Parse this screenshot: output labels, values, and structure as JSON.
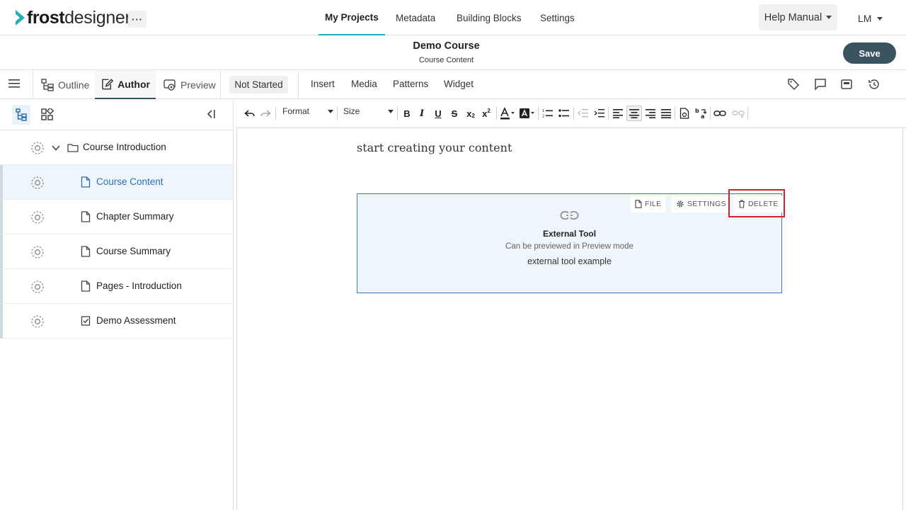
{
  "app": {
    "brand_strong": "frost",
    "brand_light": "designer",
    "more_label": "···",
    "colors": {
      "accent": "#21b0b7",
      "primary": "#3a5360",
      "selection": "#2a6fb5",
      "highlight": "#d0222a"
    }
  },
  "topnav": {
    "tabs": [
      {
        "label": "My Projects",
        "active": true
      },
      {
        "label": "Metadata"
      },
      {
        "label": "Building Blocks"
      },
      {
        "label": "Settings"
      }
    ],
    "help_label": "Help Manual",
    "user_initials": "LM"
  },
  "header": {
    "title": "Demo Course",
    "subtitle": "Course Content",
    "save_label": "Save"
  },
  "modebar": {
    "tabs": [
      {
        "label": "Outline",
        "icon": "outline-icon"
      },
      {
        "label": "Author",
        "icon": "author-icon",
        "active": true
      },
      {
        "label": "Preview",
        "icon": "preview-icon"
      }
    ],
    "status": "Not Started",
    "menu": [
      "Insert",
      "Media",
      "Patterns",
      "Widget"
    ],
    "right_icons": [
      "tag-icon",
      "comment-icon",
      "notes-icon",
      "history-icon"
    ]
  },
  "sidebar": {
    "items": [
      {
        "label": "Course Introduction",
        "type": "folder"
      },
      {
        "label": "Course Content",
        "type": "page",
        "selected": true
      },
      {
        "label": "Chapter Summary",
        "type": "page"
      },
      {
        "label": "Course Summary",
        "type": "page"
      },
      {
        "label": "Pages - Introduction",
        "type": "page"
      },
      {
        "label": "Demo Assessment",
        "type": "assessment"
      }
    ]
  },
  "editor_toolbar": {
    "format_label": "Format",
    "size_label": "Size"
  },
  "editor": {
    "placeholder_text": "start creating your content",
    "widget": {
      "file_label": "FILE",
      "settings_label": "SETTINGS",
      "delete_label": "DELETE",
      "title": "External Tool",
      "subtitle": "Can be previewed in Preview mode",
      "description": "external tool example"
    }
  }
}
